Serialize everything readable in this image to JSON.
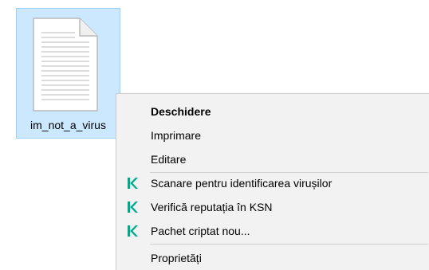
{
  "file": {
    "name": "im_not_a_virus",
    "icon": "text-document-icon"
  },
  "context_menu": {
    "items": [
      {
        "label": "Deschidere",
        "bold": true
      },
      {
        "label": "Imprimare"
      },
      {
        "label": "Editare"
      },
      {
        "label": "Scanare pentru identificarea virușilor",
        "icon": "kaspersky-k-icon"
      },
      {
        "label": "Verifică reputația în KSN",
        "icon": "kaspersky-k-icon"
      },
      {
        "label": "Pachet criptat nou...",
        "icon": "kaspersky-k-icon"
      },
      {
        "label": "Proprietăți"
      }
    ]
  },
  "colors": {
    "selection_bg": "#cce8ff",
    "selection_border": "#99d1ff",
    "menu_bg": "#f2f2f2",
    "kaspersky_green": "#00a88e"
  }
}
